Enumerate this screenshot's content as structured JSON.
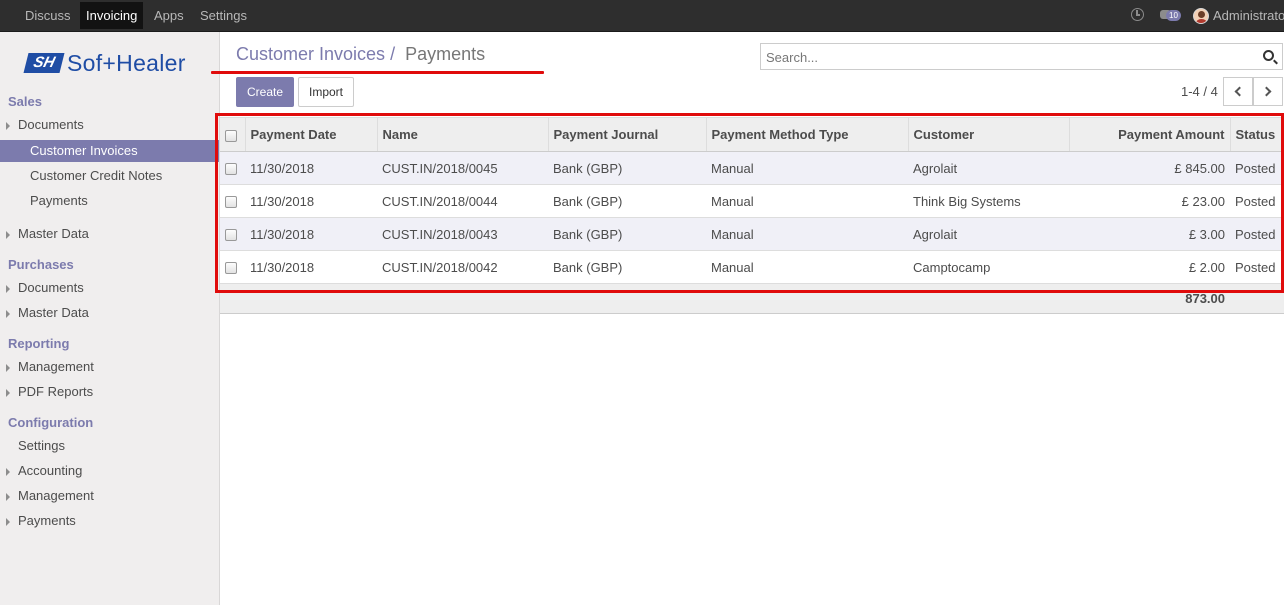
{
  "navbar": {
    "items": [
      "Discuss",
      "Invoicing",
      "Apps",
      "Settings"
    ],
    "active": "Invoicing",
    "messages_badge": "10",
    "user": "Administrator"
  },
  "sidebar": {
    "logo_mark": "SH",
    "logo_text": "Sof+Healer",
    "sections": {
      "sales": "Sales",
      "purchases": "Purchases",
      "reporting": "Reporting",
      "configuration": "Configuration"
    },
    "items": {
      "sales_documents": "Documents",
      "customer_invoices": "Customer Invoices",
      "customer_credit_notes": "Customer Credit Notes",
      "payments": "Payments",
      "sales_master_data": "Master Data",
      "purchases_documents": "Documents",
      "purchases_master_data": "Master Data",
      "reporting_management": "Management",
      "pdf_reports": "PDF Reports",
      "settings": "Settings",
      "accounting": "Accounting",
      "config_management": "Management",
      "config_payments": "Payments"
    }
  },
  "breadcrumb": {
    "parent": "Customer Invoices",
    "separator": "/",
    "current": "Payments"
  },
  "search": {
    "placeholder": "Search..."
  },
  "buttons": {
    "create": "Create",
    "import": "Import"
  },
  "pager": {
    "text": "1-4 / 4"
  },
  "table": {
    "headers": [
      "Payment Date",
      "Name",
      "Payment Journal",
      "Payment Method Type",
      "Customer",
      "Payment Amount",
      "Status"
    ],
    "rows": [
      [
        "11/30/2018",
        "CUST.IN/2018/0045",
        "Bank (GBP)",
        "Manual",
        "Agrolait",
        "£ 845.00",
        "Posted"
      ],
      [
        "11/30/2018",
        "CUST.IN/2018/0044",
        "Bank (GBP)",
        "Manual",
        "Think Big Systems",
        "£ 23.00",
        "Posted"
      ],
      [
        "11/30/2018",
        "CUST.IN/2018/0043",
        "Bank (GBP)",
        "Manual",
        "Agrolait",
        "£ 3.00",
        "Posted"
      ],
      [
        "11/30/2018",
        "CUST.IN/2018/0042",
        "Bank (GBP)",
        "Manual",
        "Camptocamp",
        "£ 2.00",
        "Posted"
      ]
    ],
    "total": "873.00"
  },
  "colors": {
    "accent": "#7c7bad",
    "navbar": "#2e2e2e",
    "annotation": "#e00b0b"
  }
}
